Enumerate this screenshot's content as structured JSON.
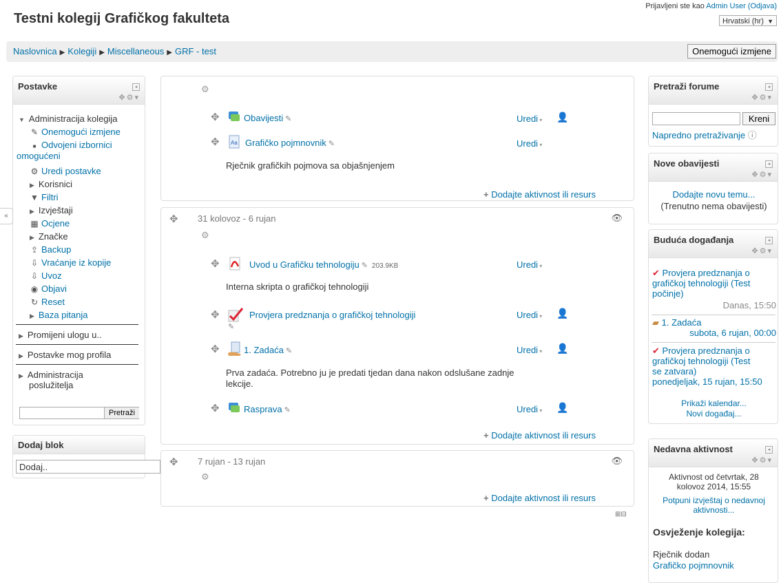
{
  "header": {
    "site_title": "Testni kolegij Grafičkog fakulteta",
    "login_prefix": "Prijavljeni ste kao",
    "login_user": "Admin User",
    "logout": "(Odjava)",
    "language": "Hrvatski (hr)"
  },
  "navbar": {
    "breadcrumbs": [
      "Naslovnica",
      "Kolegiji",
      "Miscellaneous",
      "GRF - test"
    ],
    "edit_toggle": "Onemogući izmjene"
  },
  "left": {
    "settings": {
      "title": "Postavke",
      "admin_course": "Administracija kolegija",
      "items": [
        {
          "label": "Onemogući izmjene",
          "icon": "pencil-icon"
        },
        {
          "label": "Odvojeni izbornici",
          "label2": "omogućeni",
          "icon": "bullet-icon"
        },
        {
          "label": "Uredi postavke",
          "icon": "gear-icon"
        },
        {
          "label": "Korisnici",
          "icon": "triangle-right-icon"
        },
        {
          "label": "Filtri",
          "icon": "filter-icon"
        },
        {
          "label": "Izvještaji",
          "icon": "triangle-right-icon"
        },
        {
          "label": "Ocjene",
          "icon": "grades-icon"
        },
        {
          "label": "Značke",
          "icon": "triangle-right-icon"
        },
        {
          "label": "Backup",
          "icon": "backup-icon"
        },
        {
          "label": "Vraćanje iz kopije",
          "icon": "restore-icon"
        },
        {
          "label": "Uvoz",
          "icon": "import-icon"
        },
        {
          "label": "Objavi",
          "icon": "publish-icon"
        },
        {
          "label": "Reset",
          "icon": "reset-icon"
        },
        {
          "label": "Baza pitanja",
          "icon": "triangle-right-icon"
        }
      ],
      "switch_role": "Promijeni ulogu u..",
      "profile_settings": "Postavke mog profila",
      "site_admin_1": "Administracija",
      "site_admin_2": "poslužitelja",
      "search_button": "Pretraži"
    },
    "add_block": {
      "title": "Dodaj blok",
      "select": "Dodaj.."
    }
  },
  "sections": [
    {
      "title": "",
      "activities": [
        {
          "name": "Obavijesti",
          "icon": "forum-icon",
          "edit": "Uredi",
          "person": true
        },
        {
          "name": "Grafičko pojmnovnik",
          "icon": "glossary-icon",
          "edit": "Uredi",
          "person": false
        }
      ],
      "description": "Rječnik grafičkih pojmova sa objašnjenjem",
      "add": "Dodajte aktivnost ili resurs"
    },
    {
      "title": "31 kolovoz - 6 rujan",
      "activities": [
        {
          "name": "Uvod u Grafičku tehnologiju",
          "size": "203.9KB",
          "icon": "pdf-icon",
          "edit": "Uredi",
          "person": false
        },
        {
          "name": "Provjera predznanja o grafičkoj tehnologiji",
          "icon": "quiz-icon",
          "edit": "Uredi",
          "person": true
        },
        {
          "name": "1. Zadaća",
          "icon": "assignment-icon",
          "edit": "Uredi",
          "person": true
        },
        {
          "name": "Rasprava",
          "icon": "forum-icon",
          "edit": "Uredi",
          "person": true
        }
      ],
      "desc1": "Interna skripta o grafičkoj tehnologiji",
      "desc2_line1": "Prva zadaća. Potrebno ju je predati tjedan dana nakon odslušane zadnje",
      "desc2_line2": "lekcije.",
      "add": "Dodajte aktivnost ili resurs"
    },
    {
      "title": "7 rujan - 13 rujan",
      "add": "Dodajte aktivnost ili resurs"
    }
  ],
  "right": {
    "search_forums": {
      "title": "Pretraži forume",
      "button": "Kreni",
      "advanced": "Napredno pretraživanje"
    },
    "news": {
      "title": "Nove obavijesti",
      "add_topic": "Dodajte novu temu...",
      "empty": "(Trenutno nema obavijesti)"
    },
    "upcoming": {
      "title": "Buduća događanja",
      "events": [
        {
          "l1": "Provjera predznanja o",
          "l2": "grafičkoj tehnologiji (Test",
          "l3": "počinje)",
          "date": "Danas, 15:50"
        },
        {
          "l1": "1. Zadaća",
          "date": "subota, 6 rujan, 00:00"
        },
        {
          "l1": "Provjera predznanja o",
          "l2": "grafičkoj tehnologiji (Test",
          "l3": "se zatvara)",
          "date": "ponedjeljak, 15 rujan, 15:50"
        }
      ],
      "show_calendar": "Prikaži kalendar...",
      "new_event": "Novi događaj..."
    },
    "recent": {
      "title": "Nedavna aktivnost",
      "since_l1": "Aktivnost od četvrtak, 28",
      "since_l2": "kolovoz 2014, 15:55",
      "full_l1": "Potpuni izvještaj o nedavnoj",
      "full_l2": "aktivnosti...",
      "updates_title": "Osvježenje kolegija:",
      "update_l1": "Rječnik dodan",
      "update_l2": "Grafičko pojmnovnik"
    }
  },
  "colors": {
    "link": "#0070a8",
    "block_border": "#dddddd",
    "navbar": "#eeeeee"
  }
}
